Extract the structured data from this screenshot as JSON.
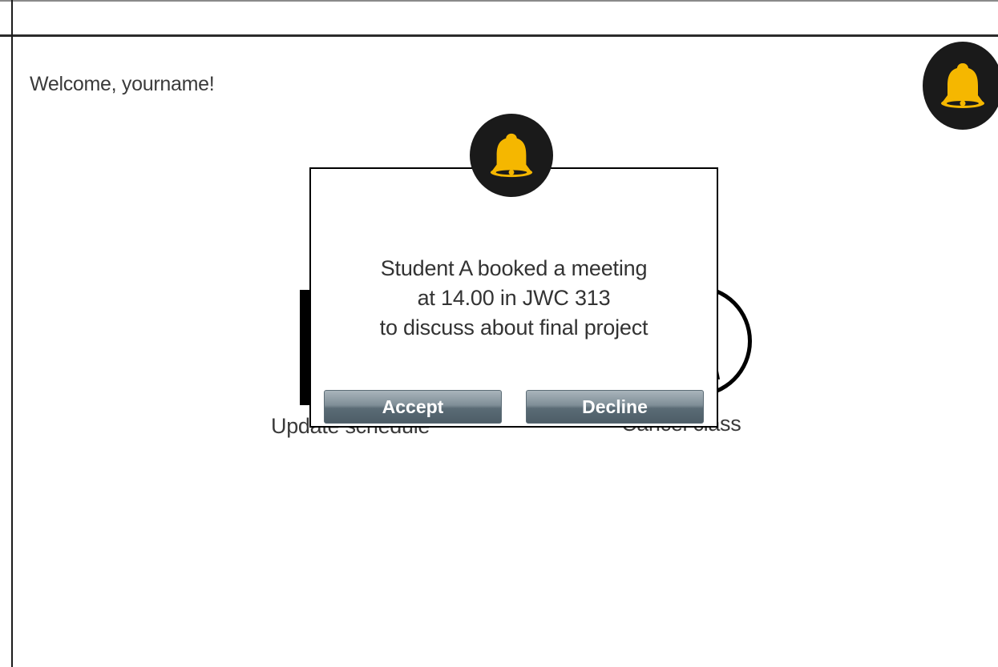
{
  "header": {
    "welcome_text": "Welcome, yourname!"
  },
  "tiles": [
    {
      "label": "Update schedule",
      "icon": "calendar-icon"
    },
    {
      "label": "Cancel class",
      "icon": "cancel-clock-icon"
    }
  ],
  "notification": {
    "icon": "bell-icon",
    "message_lines": [
      "Student A booked a meeting",
      "at 14.00 in JWC 313",
      "to discuss about final project"
    ],
    "accept_label": "Accept",
    "decline_label": "Decline"
  },
  "colors": {
    "bell_fill": "#f5b700",
    "bell_bg": "#1a1a1a",
    "button_gradient_top": "#a9b4bb",
    "button_gradient_bottom": "#4d5d67"
  }
}
